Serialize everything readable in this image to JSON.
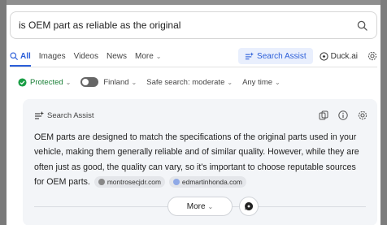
{
  "search": {
    "query": "is OEM part as reliable as the original"
  },
  "tabs": [
    {
      "label": "All",
      "active": true
    },
    {
      "label": "Images"
    },
    {
      "label": "Videos"
    },
    {
      "label": "News"
    },
    {
      "label": "More"
    }
  ],
  "assist_button": "Search Assist",
  "duckai_button": "Duck.ai",
  "filters": {
    "protected": "Protected",
    "region": "Finland",
    "safe_search": "Safe search: moderate",
    "time": "Any time"
  },
  "assist_card": {
    "title": "Search Assist",
    "body": "OEM parts are designed to match the specifications of the original parts used in your vehicle, making them generally reliable and of similar quality. However, while they are often just as good, the quality can vary, so it's important to choose reputable sources for OEM parts.",
    "sources": [
      "montrosecjdr.com",
      "edmartinhonda.com"
    ],
    "more_label": "More"
  },
  "colors": {
    "accent": "#2b5ed9",
    "protected": "#1a7f37",
    "card_bg": "#f3f5f8"
  }
}
